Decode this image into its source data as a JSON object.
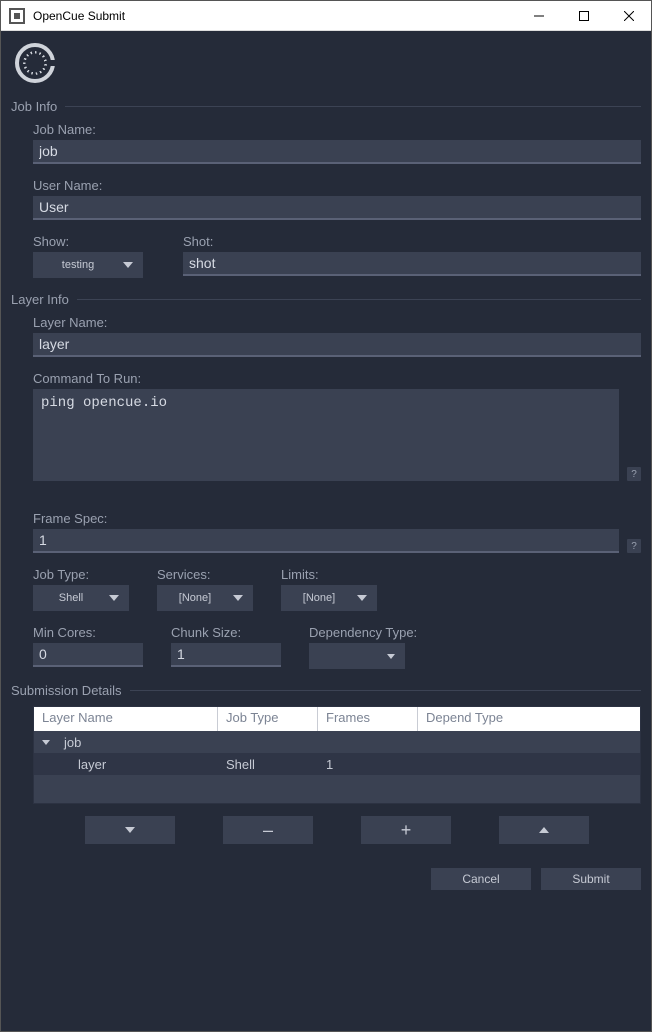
{
  "window": {
    "title": "OpenCue Submit"
  },
  "jobInfo": {
    "heading": "Job Info",
    "jobName": {
      "label": "Job Name:",
      "value": "job"
    },
    "userName": {
      "label": "User Name:",
      "value": "User"
    },
    "show": {
      "label": "Show:",
      "value": "testing"
    },
    "shot": {
      "label": "Shot:",
      "value": "shot"
    }
  },
  "layerInfo": {
    "heading": "Layer Info",
    "layerName": {
      "label": "Layer Name:",
      "value": "layer"
    },
    "command": {
      "label": "Command To Run:",
      "value": "ping opencue.io"
    },
    "frameSpec": {
      "label": "Frame Spec:",
      "value": "1"
    },
    "jobType": {
      "label": "Job Type:",
      "value": "Shell"
    },
    "services": {
      "label": "Services:",
      "value": "[None]"
    },
    "limits": {
      "label": "Limits:",
      "value": "[None]"
    },
    "minCores": {
      "label": "Min Cores:",
      "value": "0"
    },
    "chunkSize": {
      "label": "Chunk Size:",
      "value": "1"
    },
    "depType": {
      "label": "Dependency Type:",
      "value": ""
    }
  },
  "submission": {
    "heading": "Submission Details",
    "columns": {
      "layerName": "Layer Name",
      "jobType": "Job Type",
      "frames": "Frames",
      "dependType": "Depend Type"
    },
    "rows": {
      "job": {
        "name": "job"
      },
      "layer": {
        "name": "layer",
        "jobType": "Shell",
        "frames": "1"
      }
    }
  },
  "glyphs": {
    "minus": "–",
    "plus": "+",
    "help": "?"
  },
  "footer": {
    "cancel": "Cancel",
    "submit": "Submit"
  }
}
